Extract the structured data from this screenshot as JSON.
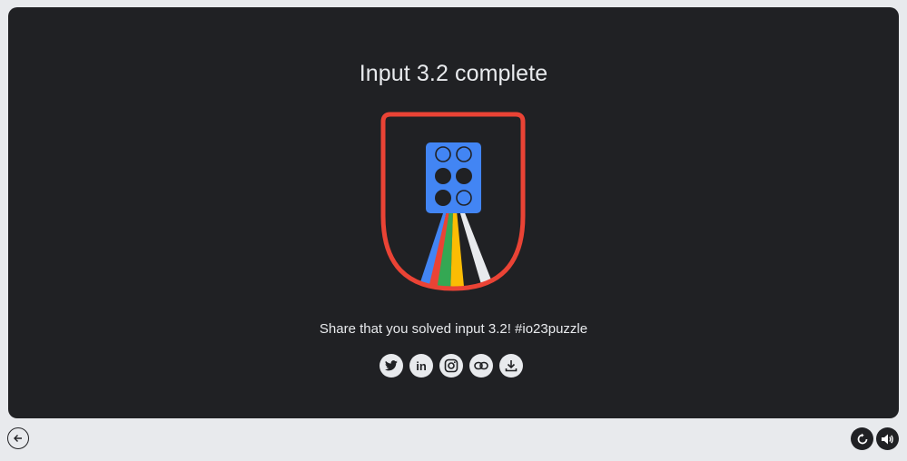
{
  "title": "Input 3.2 complete",
  "share_text": "Share that you solved input 3.2! #io23puzzle",
  "badge": {
    "icon": "braille-cell-icon",
    "dots_filled": [
      false,
      false,
      true,
      true,
      true,
      false
    ],
    "colors": {
      "shield_outline": "#ea4335",
      "cell": "#4285f4",
      "stripes": [
        "#4285f4",
        "#ea4335",
        "#34a853",
        "#fbbc04",
        "#ffffff"
      ]
    }
  },
  "share_buttons": [
    {
      "name": "twitter",
      "icon": "twitter-icon"
    },
    {
      "name": "linkedin",
      "icon": "linkedin-icon",
      "text": "in"
    },
    {
      "name": "instagram",
      "icon": "instagram-icon"
    },
    {
      "name": "copy-link",
      "icon": "link-icon"
    },
    {
      "name": "download",
      "icon": "download-icon"
    }
  ],
  "controls": {
    "back": "arrow-left-icon",
    "reset": "refresh-icon",
    "sound": "volume-icon"
  },
  "colors": {
    "panel_bg": "#202124",
    "page_bg": "#e8eaed",
    "text": "#e8eaed"
  }
}
